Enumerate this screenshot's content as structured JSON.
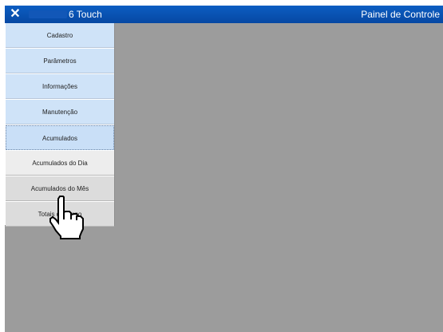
{
  "window": {
    "close_glyph": "✕",
    "app_title": "6 Touch",
    "panel_title": "Painel de Controle"
  },
  "menu": {
    "items": [
      {
        "label": "Cadastro"
      },
      {
        "label": "Parâmetros"
      },
      {
        "label": "Informações"
      },
      {
        "label": "Manutenção"
      },
      {
        "label": "Acumulados"
      },
      {
        "label": "Acumulados do Dia"
      },
      {
        "label": "Acumulados do Mês"
      },
      {
        "label": "Totais do Turno"
      }
    ]
  },
  "cursor": {
    "icon": "hand-pointer-icon"
  },
  "colors": {
    "titlebar": "#0648a3",
    "menu_blue": "#cfe3f8",
    "workspace": "#9c9c9c"
  }
}
